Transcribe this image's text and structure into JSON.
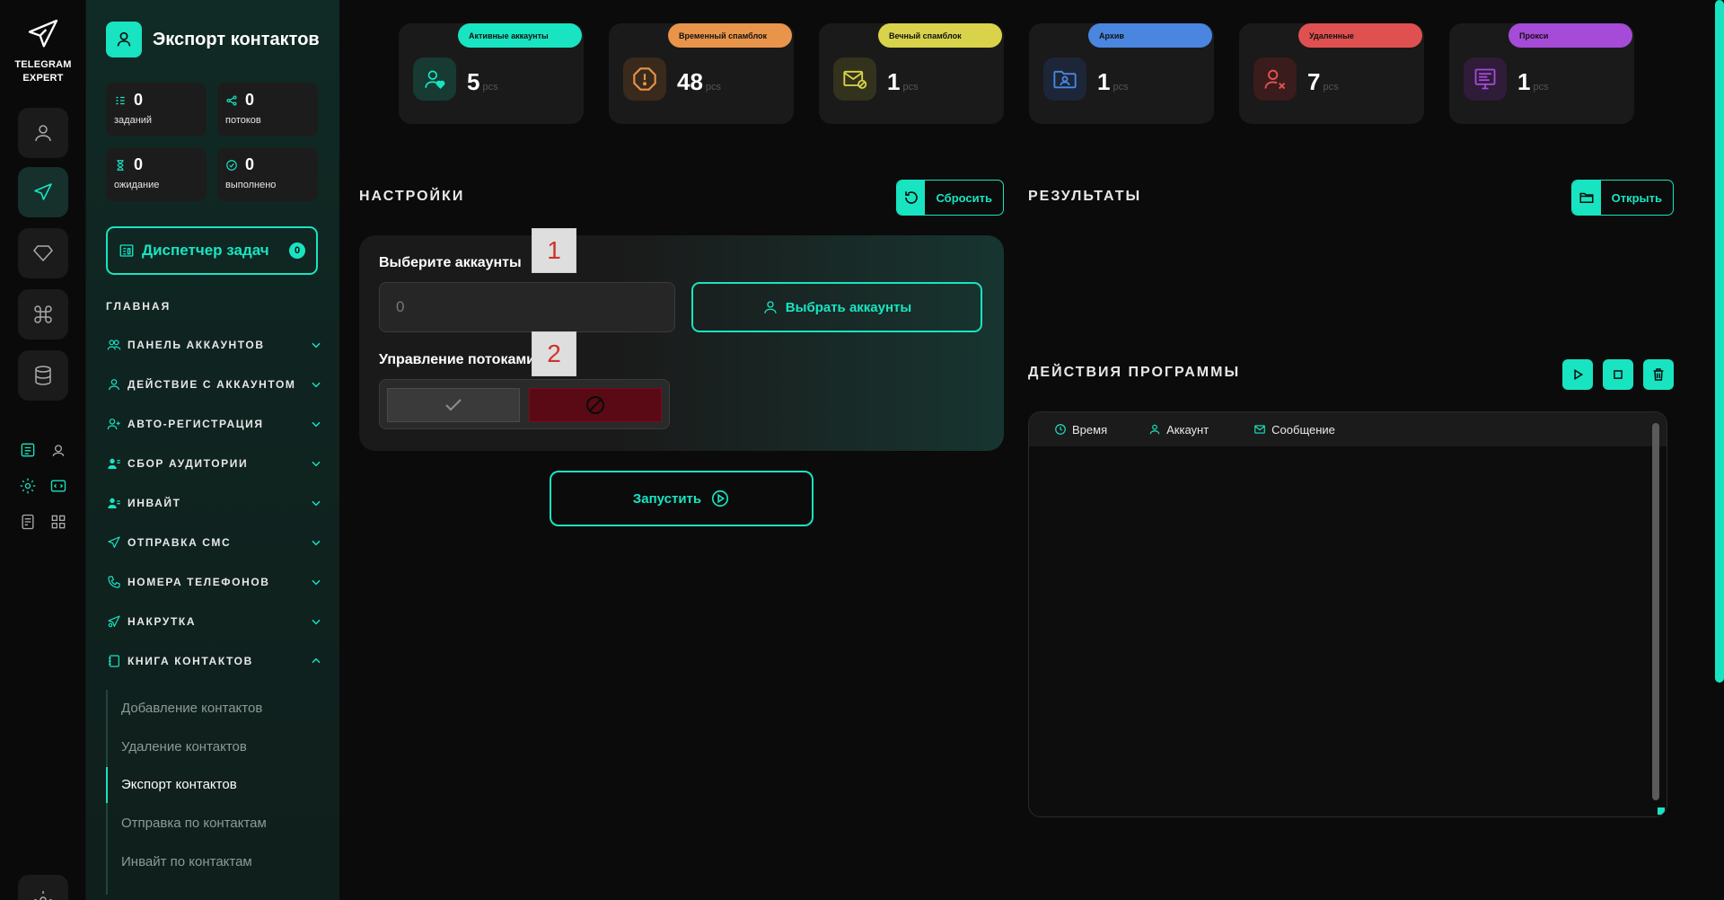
{
  "rail": {
    "logo_line1": "TELEGRAM",
    "logo_line2": "EXPERT"
  },
  "sidebar": {
    "title": "Экспорт контактов",
    "stats": [
      {
        "value": "0",
        "label": "заданий"
      },
      {
        "value": "0",
        "label": "потоков"
      },
      {
        "value": "0",
        "label": "ожидание"
      },
      {
        "value": "0",
        "label": "выполнено"
      }
    ],
    "dispatcher": {
      "label": "Диспетчер задач",
      "badge": "0"
    },
    "section": "ГЛАВНАЯ",
    "menu": [
      {
        "label": "ПАНЕЛЬ АККАУНТОВ"
      },
      {
        "label": "ДЕЙСТВИЕ С АККАУНТОМ"
      },
      {
        "label": "АВТО-РЕГИСТРАЦИЯ"
      },
      {
        "label": "СБОР АУДИТОРИИ"
      },
      {
        "label": "ИНВАЙТ"
      },
      {
        "label": "ОТПРАВКА СМС"
      },
      {
        "label": "НОМЕРА ТЕЛЕФОНОВ"
      },
      {
        "label": "НАКРУТКА"
      },
      {
        "label": "КНИГА КОНТАКТОВ"
      }
    ],
    "submenu": [
      {
        "label": "Добавление контактов"
      },
      {
        "label": "Удаление контактов"
      },
      {
        "label": "Экспорт контактов"
      },
      {
        "label": "Отправка по контактам"
      },
      {
        "label": "Инвайт по контактам"
      }
    ]
  },
  "cards": [
    {
      "pill": "Активные аккаунты",
      "value": "5",
      "unit": "pcs",
      "color": "#18e4c1",
      "icon": "user-heart-icon"
    },
    {
      "pill": "Временный спамблок",
      "value": "48",
      "unit": "pcs",
      "color": "#e8944a",
      "icon": "warning-octagon-icon"
    },
    {
      "pill": "Вечный спамблок",
      "value": "1",
      "unit": "pcs",
      "color": "#d8d34a",
      "icon": "mail-blocked-icon"
    },
    {
      "pill": "Архив",
      "value": "1",
      "unit": "pcs",
      "color": "#4a86e0",
      "icon": "archive-folder-icon"
    },
    {
      "pill": "Удаленные",
      "value": "7",
      "unit": "pcs",
      "color": "#e05050",
      "icon": "user-remove-icon"
    },
    {
      "pill": "Прокси",
      "value": "1",
      "unit": "pcs",
      "color": "#a64ad8",
      "icon": "proxy-icon"
    }
  ],
  "settings": {
    "title": "НАСТРОЙКИ",
    "reset_label": "Сбросить",
    "accounts_label": "Выберите аккаунты",
    "accounts_value": "0",
    "marker1": "1",
    "choose_label": "Выбрать аккаунты",
    "threads_label": "Управление потоками",
    "marker2": "2",
    "run_label": "Запустить"
  },
  "results": {
    "title": "РЕЗУЛЬТАТЫ",
    "open_label": "Открыть"
  },
  "actions": {
    "title": "ДЕЙСТВИЯ ПРОГРАММЫ",
    "columns": [
      "Время",
      "Аккаунт",
      "Сообщение"
    ]
  }
}
